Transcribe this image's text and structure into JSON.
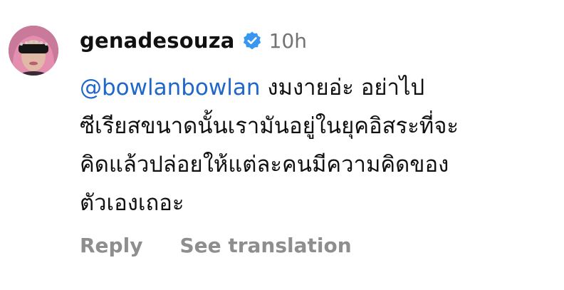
{
  "comment": {
    "username": "genadesouza",
    "verified_icon": "verified-badge-icon",
    "time": "10h",
    "mention": "@bowlanbowlan",
    "lines": [
      " งมงายอ่ะ อย่าไป",
      "ซีเรียสขนาดนั้นเรามันอยู่ในยุคอิสระที่จะ",
      "คิดแล้วปล่อยให้แต่ละคนมีความคิดของ",
      "ตัวเองเถอะ"
    ],
    "actions": {
      "reply": "Reply",
      "see_translation": "See translation"
    }
  },
  "colors": {
    "mention": "#2167c9",
    "verified": "#3897f0",
    "muted": "#8e8e8e",
    "time": "#737373"
  }
}
